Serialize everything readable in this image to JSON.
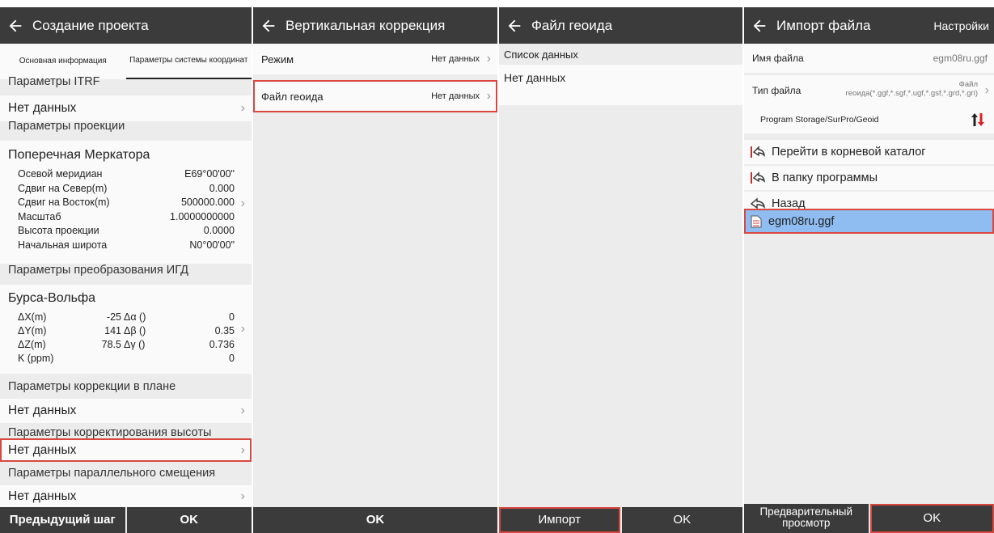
{
  "panel1": {
    "title": "Создание проекта",
    "tabs": [
      "Основная информация",
      "Параметры системы координат"
    ],
    "itrf_section": "Параметры ITRF",
    "itrf_value": "Нет данных",
    "projection_section": "Параметры проекции",
    "projection_name": "Поперечная Меркатора",
    "projection_params": [
      {
        "label": "Осевой меридиан",
        "value": "E69°00'00\""
      },
      {
        "label": "Сдвиг на Север(m)",
        "value": "0.000"
      },
      {
        "label": "Сдвиг на Восток(m)",
        "value": "500000.000"
      },
      {
        "label": "Масштаб",
        "value": "1.0000000000"
      },
      {
        "label": "Высота проекции",
        "value": "0.0000"
      },
      {
        "label": "Начальная широта",
        "value": "N0°00'00\""
      }
    ],
    "igd_section": "Параметры преобразования ИГД",
    "igd_name": "Бурса-Вольфа",
    "igd_params": [
      {
        "label": "ΔX(m)",
        "value": "-25",
        "label2": "Δα ()",
        "value2": "0"
      },
      {
        "label": "ΔY(m)",
        "value": "141",
        "label2": "Δβ ()",
        "value2": "0.35"
      },
      {
        "label": "ΔZ(m)",
        "value": "78.5",
        "label2": "Δγ ()",
        "value2": "0.736"
      },
      {
        "label": "K (ppm)",
        "value": "",
        "label2": "",
        "value2": "0"
      }
    ],
    "plane_section": "Параметры коррекции в плане",
    "plane_value": "Нет данных",
    "height_section": "Параметры корректирования высоты",
    "height_value": "Нет данных",
    "parallel_section": "Параметры параллельного смещения",
    "parallel_value": "Нет данных",
    "prev_button": "Предыдущий шаг",
    "ok_button": "OK"
  },
  "panel2": {
    "title": "Вертикальная коррекция",
    "mode_label": "Режим",
    "mode_value": "Нет данных",
    "geoid_label": "Файл геоида",
    "geoid_value": "Нет данных",
    "ok_button": "OK"
  },
  "panel3": {
    "title": "Файл геоида",
    "list_header": "Список данных",
    "empty_text": "Нет данных",
    "import_button": "Импорт",
    "ok_button": "OK"
  },
  "panel4": {
    "title": "Импорт файла",
    "settings": "Настройки",
    "filename_label": "Имя файла",
    "filename_value": "egm08ru.ggf",
    "filetype_label": "Тип файла",
    "filetype_value_line1": "Файл",
    "filetype_value_line2": "геоида(*.ggf,*.sgf,*.ugf,*.gsf,*.grd,*.gri)",
    "path": "Program Storage/SurPro/Geoid",
    "root_label": "Перейти в корневой каталог",
    "app_folder_label": "В папку программы",
    "back_label": "Назад",
    "file_item": "egm08ru.ggf",
    "preview_button": "Предварительный просмотр",
    "ok_button": "OK"
  },
  "colors": {
    "header": "#3b3b3b",
    "highlight": "#d9473f",
    "selected_row": "#8fbdf2",
    "sort_up": "#222222",
    "sort_down": "#e02020"
  }
}
